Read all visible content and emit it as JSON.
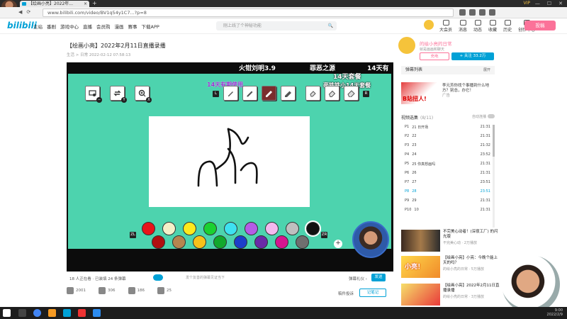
{
  "browser": {
    "tab_title": "【绘画小亮】2022年...",
    "tab_close": "×",
    "new_tab": "+",
    "url": "www.bilibili.com/video/BV1q54y1C7...?p=8",
    "vip": "VIP",
    "window_controls": [
      "—",
      "☐",
      "✕"
    ],
    "nav": [
      "◀",
      "▶",
      "⟳",
      "⌂"
    ]
  },
  "bili": {
    "logo": "bilibili",
    "nav_items": [
      "主站",
      "番剧",
      "游戏中心",
      "直播",
      "会员购",
      "漫画",
      "赛事",
      "下载APP"
    ],
    "search_placeholder": "刚上线了个神秘功能",
    "search_icon": "🔍",
    "user_nav": [
      "大会员",
      "消息",
      "动态",
      "收藏",
      "历史",
      "创作中心"
    ],
    "upload_label": "投稿"
  },
  "video": {
    "title": "【绘画小亮】2022年2月11日直播录播",
    "meta": "生活 > 日常   2022-02-12 07:58:13"
  },
  "player": {
    "danmaku": [
      "火钳刘明3.9",
      "罪恶之源",
      "14天有",
      "14天套餐",
      "毫铁铁小14天套餐"
    ],
    "danmaku_purple": "14天有期使用",
    "tool_keys": [
      "L",
      "R",
      "ZL",
      "ZR"
    ],
    "tool_subkeys": [
      "−",
      "Y",
      "X"
    ],
    "colors_row1": [
      "#e8141a",
      "#f4f0c8",
      "#ffe91d",
      "#1bd131",
      "#3ee1f1",
      "#b55ce6",
      "#f4b8ee",
      "#bfbfbf",
      "#111111"
    ],
    "colors_row2": [
      "#b01010",
      "#b5854f",
      "#f7c11a",
      "#12a82c",
      "#1d3fc9",
      "#6a2aa8",
      "#d4168f",
      "#6f6f6f"
    ],
    "plus": "+"
  },
  "player_bar": {
    "online": "18 人正在看 · 已装填 24 条弹幕",
    "dm_placeholder": "发个友善的弹幕见证当下",
    "etiquette": "弹幕礼仪 ›",
    "send": "发送"
  },
  "actions": {
    "like": "2001",
    "coin": "306",
    "fav": "186",
    "share": "25",
    "report": "稿件投诉",
    "note": "记笔记"
  },
  "sidebar": {
    "up_name": "的绘小亮的日常",
    "up_desc": "就是画画和聊天",
    "charge": "充电",
    "follow": "+ 关注 33.2万",
    "danmaku_list": "弹幕列表",
    "danmaku_list_right": "展开",
    "ad_text": "李元芳你找个事播到什么地方？别怂，办它！",
    "ad_sub": "广告",
    "ad_thumb_text": "B站扭人!",
    "playlist_title": "视频选集",
    "playlist_count": "(8/11)",
    "autoplay": "自动连播",
    "playlist": [
      {
        "p": "P1",
        "t": "21 日开场",
        "d": "21:31"
      },
      {
        "p": "P2",
        "t": "22",
        "d": "21:31"
      },
      {
        "p": "P3",
        "t": "23",
        "d": "21:32"
      },
      {
        "p": "P4",
        "t": "24",
        "d": "23:52"
      },
      {
        "p": "P5",
        "t": "25 你真想画吗",
        "d": "21:31"
      },
      {
        "p": "P6",
        "t": "26",
        "d": "21:31"
      },
      {
        "p": "P7",
        "t": "27",
        "d": "23:51"
      },
      {
        "p": "P8",
        "t": "28",
        "d": "23:51"
      },
      {
        "p": "P9",
        "t": "29",
        "d": "21:31"
      },
      {
        "p": "P10",
        "t": "10",
        "d": "21:31"
      }
    ],
    "recs": [
      {
        "title": "不完美心动者！(深夜工厂) 的闪光版",
        "meta": "不完美心动 · 2万播放"
      },
      {
        "title": "【绘画小亮】小亮：今晚个能上天的吗？",
        "meta": "的绘小亮的日常 · 5万播放"
      },
      {
        "title": "【绘画小亮】2022年2月11日直播录播",
        "meta": "的绘小亮的日常 · 3万播放"
      }
    ],
    "rec_badge": "小亮！"
  },
  "taskbar": {
    "time": "9:00",
    "date": "2022/2/9"
  }
}
